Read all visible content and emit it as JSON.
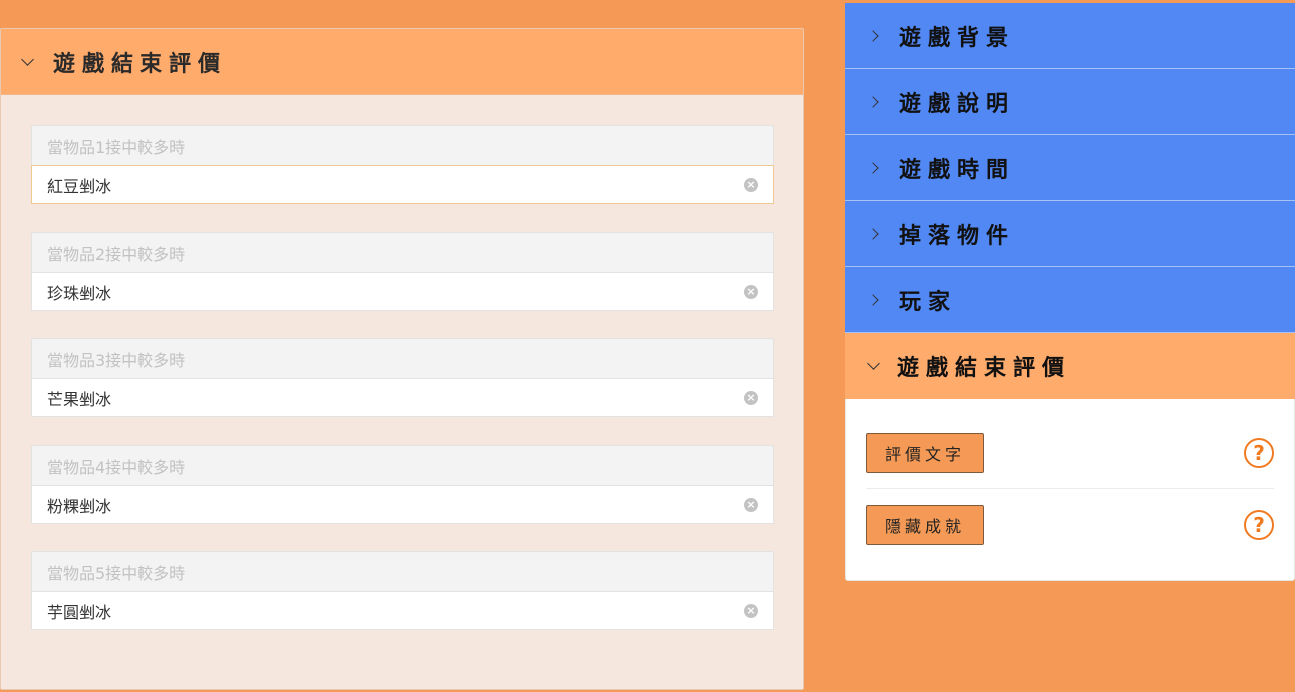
{
  "left_panel": {
    "title": "遊戲結束評價",
    "fields": [
      {
        "label": "當物品1接中較多時",
        "value": "紅豆剉冰"
      },
      {
        "label": "當物品2接中較多時",
        "value": "珍珠剉冰"
      },
      {
        "label": "當物品3接中較多時",
        "value": "芒果剉冰"
      },
      {
        "label": "當物品4接中較多時",
        "value": "粉粿剉冰"
      },
      {
        "label": "當物品5接中較多時",
        "value": "芋圓剉冰"
      }
    ]
  },
  "right_panel": {
    "sections": [
      {
        "label": "遊戲背景"
      },
      {
        "label": "遊戲說明"
      },
      {
        "label": "遊戲時間"
      },
      {
        "label": "掉落物件"
      },
      {
        "label": "玩家"
      },
      {
        "label": "遊戲結束評價"
      }
    ],
    "buttons": [
      {
        "label": "評價文字"
      },
      {
        "label": "隱藏成就"
      }
    ]
  },
  "icons": {
    "clear": "clear-icon",
    "help": "help-icon",
    "chevron_down": "chevron-down-icon",
    "chevron_right": "chevron-right-icon"
  },
  "colors": {
    "background": "#f59a56",
    "header_orange": "#ffab6c",
    "accordion_blue": "#5288f3",
    "help_orange": "#f07a1f"
  }
}
